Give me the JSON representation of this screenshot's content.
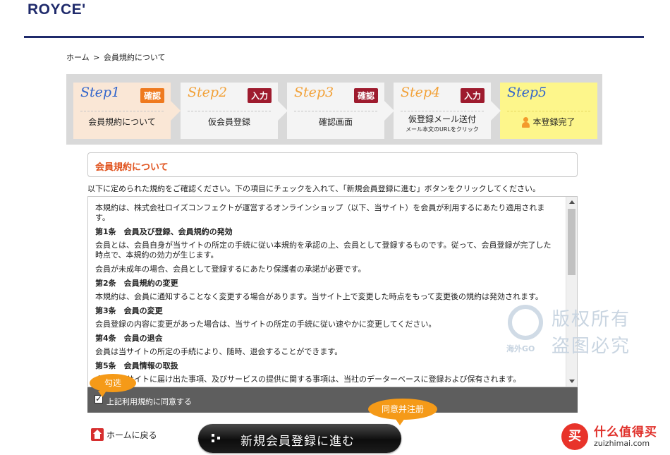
{
  "brand": {
    "logo": "ROYCE'"
  },
  "breadcrumb": {
    "home": "ホーム",
    "sep": ">",
    "current": "会員規約について"
  },
  "steps": [
    {
      "name": "Step1",
      "badge": "確認",
      "label": "会員規約について"
    },
    {
      "name": "Step2",
      "badge": "入力",
      "label": "仮会員登録"
    },
    {
      "name": "Step3",
      "badge": "確認",
      "label": "確認画面"
    },
    {
      "name": "Step4",
      "badge": "入力",
      "label": "仮登録メール送付",
      "sublabel": "メール本文のURLをクリック"
    },
    {
      "name": "Step5",
      "label": "本登録完了",
      "icon": "person-icon"
    }
  ],
  "section": {
    "title": "会員規約について"
  },
  "intro": "以下に定められた規約をご確認ください。下の項目にチェックを入れて、「新規会員登録に進む」ボタンをクリックしてください。",
  "terms": {
    "intro": "本規約は、株式会社ロイズコンフェクトが運営するオンラインショップ（以下、当サイト）を会員が利用するにあたり適用されます。",
    "articles": [
      {
        "heading": "第1条　会員及び登録、会員規約の発効",
        "paras": [
          "会員とは、会員自身が当サイトの所定の手続に従い本規約を承認の上、会員として登録するものです。従って、会員登録が完了した時点で、本規約の効力が生じます。",
          "会員が未成年の場合、会員として登録するにあたり保護者の承諾が必要です。"
        ]
      },
      {
        "heading": "第2条　会員規約の変更",
        "paras": [
          "本規約は、会員に通知することなく変更する場合があります。当サイト上で変更した時点をもって変更後の規約は発効されます。"
        ]
      },
      {
        "heading": "第3条　会員の変更",
        "paras": [
          "会員登録の内容に変更があった場合は、当サイトの所定の手続に従い速やかに変更してください。"
        ]
      },
      {
        "heading": "第4条　会員の退会",
        "paras": [
          "会員は当サイトの所定の手続により、随時、退会することができます。"
        ]
      },
      {
        "heading": "第5条　会員情報の取扱",
        "paras": [
          "会員が当サイトに届け出た事項、及びサービスの提供に関する事項は、当社のデーターベースに登録および保有されます。"
        ]
      }
    ]
  },
  "agree": {
    "label": "上記利用規約に同意する",
    "checked": true
  },
  "annotations": {
    "check": "勾选",
    "submit": "同意并注册"
  },
  "home_link": "ホームに戻る",
  "cta": "新規会員登録に進む",
  "watermark1": {
    "brand": "海外GO",
    "line1": "版权所有",
    "line2": "盗图必究"
  },
  "watermark2": {
    "glyph": "买",
    "name": "什么值得买",
    "url": "zuizhimai.com"
  },
  "colors": {
    "navy": "#1f2a6b",
    "accent": "#e0531e",
    "badge_orange": "#ef7a1f",
    "badge_red": "#9e1b2e",
    "bubble": "#f59a18"
  }
}
